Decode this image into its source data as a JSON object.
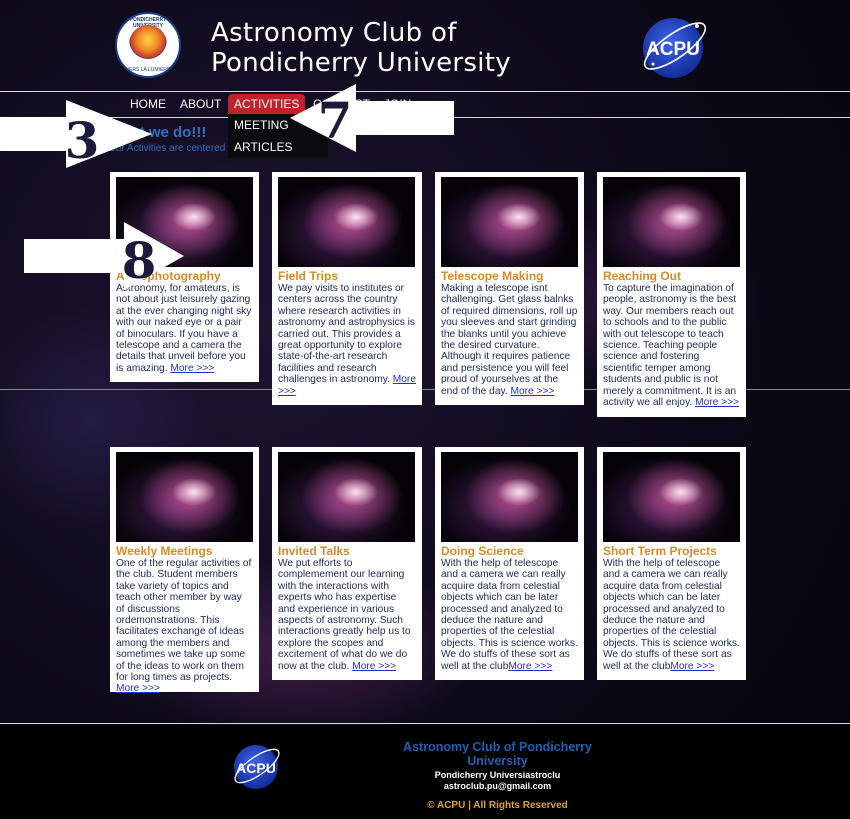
{
  "header": {
    "title_line1": "Astronomy Club of",
    "title_line2": "Pondicherry University",
    "uni_logo_text": "PONDICHERRY UNIVERSITY",
    "uni_logo_motto": "VERS LA LUMIERE",
    "acpu_logo_text": "ACPU"
  },
  "nav": {
    "items": [
      {
        "label": "HOME"
      },
      {
        "label": "ABOUT"
      },
      {
        "label": "ACTIVITIES"
      },
      {
        "label": "CONTACT"
      },
      {
        "label": "JOIN"
      }
    ],
    "dropdown": [
      {
        "label": "MEETING"
      },
      {
        "label": "ARTICLES"
      }
    ]
  },
  "intro": {
    "heading": "What we do!!!",
    "text": "Our Activities are centered around the following"
  },
  "annotations": [
    {
      "label": "3"
    },
    {
      "label": "7"
    },
    {
      "label": "8"
    }
  ],
  "cards": [
    {
      "title": "Astrophotography",
      "text": "Astronomy, for amateurs, is not about just leisurely gazing at the ever changing night sky with our naked eye or a pair of binoculars. If you have a telescope and a camera the details that unveil before you is amazing.",
      "more": "More >>>"
    },
    {
      "title": "Field Trips",
      "text": "We pay visits to institutes or centers across the country where research activities in astronomy and astrophysics is carried out. This provides a great opportunity to explore state-of-the-art research facilities and research challenges in astronomy.",
      "more": "More >>>"
    },
    {
      "title": "Telescope Making",
      "text": "Making a telescope isnt challenging. Get glass balnks of required dimensions, roll up you sleeves and start grinding the blanks until you achieve the desired curvature. Although it requires patience and persistence you will feel proud of yourselves at the end of the day.",
      "more": "More >>>"
    },
    {
      "title": "Reaching Out",
      "text": "To capture the imagination of people, astronomy is the best way. Our members reach out to schools and to the public with out telescope to teach science. Teaching people science and fostering scientific temper among students and public is not merely a commitment. It is an activity we all enjoy.",
      "more": "More >>>"
    },
    {
      "title": "Weekly Meetings",
      "text": "One of the regular activities of the club. Student members take variety of topics and teach other member by way of discussions ordemonstrations. This facilitates exchange of ideas among the members and sometimes we take up some of the ideas to work on them for long times as projects.",
      "more": "More >>>"
    },
    {
      "title": "Invited Talks",
      "text": "We put efforts to complemement our learning with the interactions with experts who has expertise and experience in various aspects of astronomy. Such interactions greatly help us to explore the scopes and excitement of what do we do now at the club.",
      "more": "More >>>"
    },
    {
      "title": "Doing Science",
      "text": "With the help of telescope and a camera we can really acquire data from celestial objects which can be later processed and analyzed to deduce the nature and properties of the celestial objects. This is science works. We do stuffs of these sort as well at the club",
      "more": "More >>>"
    },
    {
      "title": "Short Term Projects",
      "text": "With the help of telescope and a camera we can really acquire data from celestial objects which can be later processed and analyzed to deduce the nature and properties of the celestial objects. This is science works. We do stuffs of these sort as well at the club",
      "more": "More >>>"
    }
  ],
  "footer": {
    "title": "Astronomy Club of Pondicherry University",
    "line1": "Pondicherry Universiastroclu",
    "line2": "astroclub.pu@gmail.com",
    "copyright": "© ACPU | All Rights Reserved",
    "logo_text": "ACPU"
  },
  "colors": {
    "nav_active": "#c0212b",
    "card_title": "#d88a26",
    "intro_blue": "#2f6fc2",
    "footer_title": "#1f5fb8",
    "footer_copy": "#e0a030"
  }
}
